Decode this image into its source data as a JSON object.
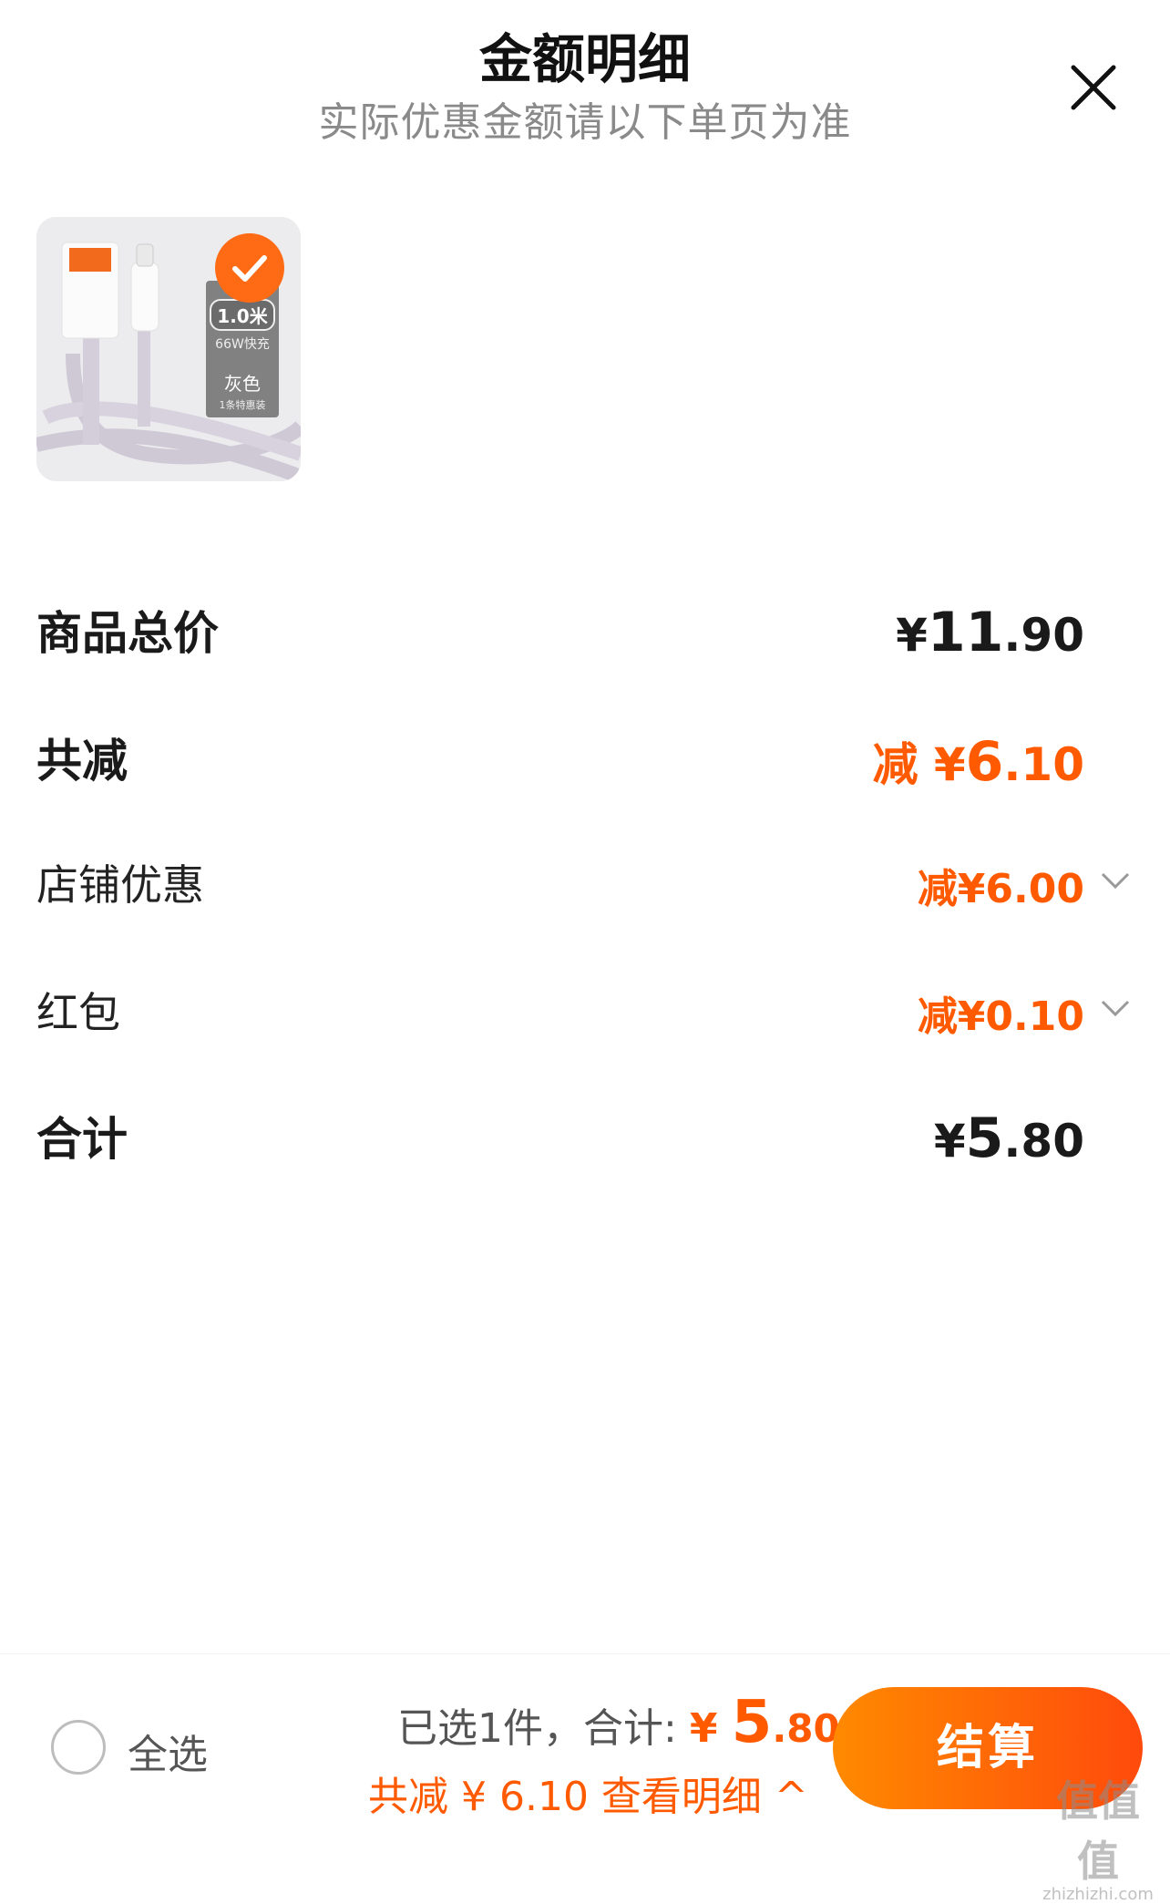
{
  "header": {
    "title": "金额明细",
    "subtitle": "实际优惠金额请以下单页为准"
  },
  "product": {
    "tag_length": "1.0米",
    "tag_feature": "66W快充",
    "tag_color": "灰色",
    "tag_pack": "1条特惠装",
    "selected": true
  },
  "rows": {
    "subtotal": {
      "label": "商品总价",
      "currency": "¥",
      "int": "11",
      "dec": ".90"
    },
    "discount": {
      "label": "共减",
      "prefix": "减 ",
      "currency": "¥",
      "int": "6",
      "dec": ".10"
    },
    "shop_coupon": {
      "label": "店铺优惠",
      "value": "减¥6.00"
    },
    "red_packet": {
      "label": "红包",
      "value": "减¥0.10"
    },
    "total": {
      "label": "合计",
      "currency": "¥",
      "int": "5",
      "dec": ".80"
    }
  },
  "footer": {
    "select_all": "全选",
    "summary_prefix": "已选1件，合计:",
    "total_currency": "¥",
    "total_int": "5",
    "total_dec": ".80",
    "discount_detail": "共减 ¥ 6.10 查看明细 ^",
    "checkout": "结算"
  },
  "watermark": {
    "text": "值值值",
    "url": "zhizhizhi.com"
  },
  "colors": {
    "accent": "#ff5a00",
    "gradient_start": "#ff8a00",
    "gradient_end": "#ff4a0c"
  }
}
